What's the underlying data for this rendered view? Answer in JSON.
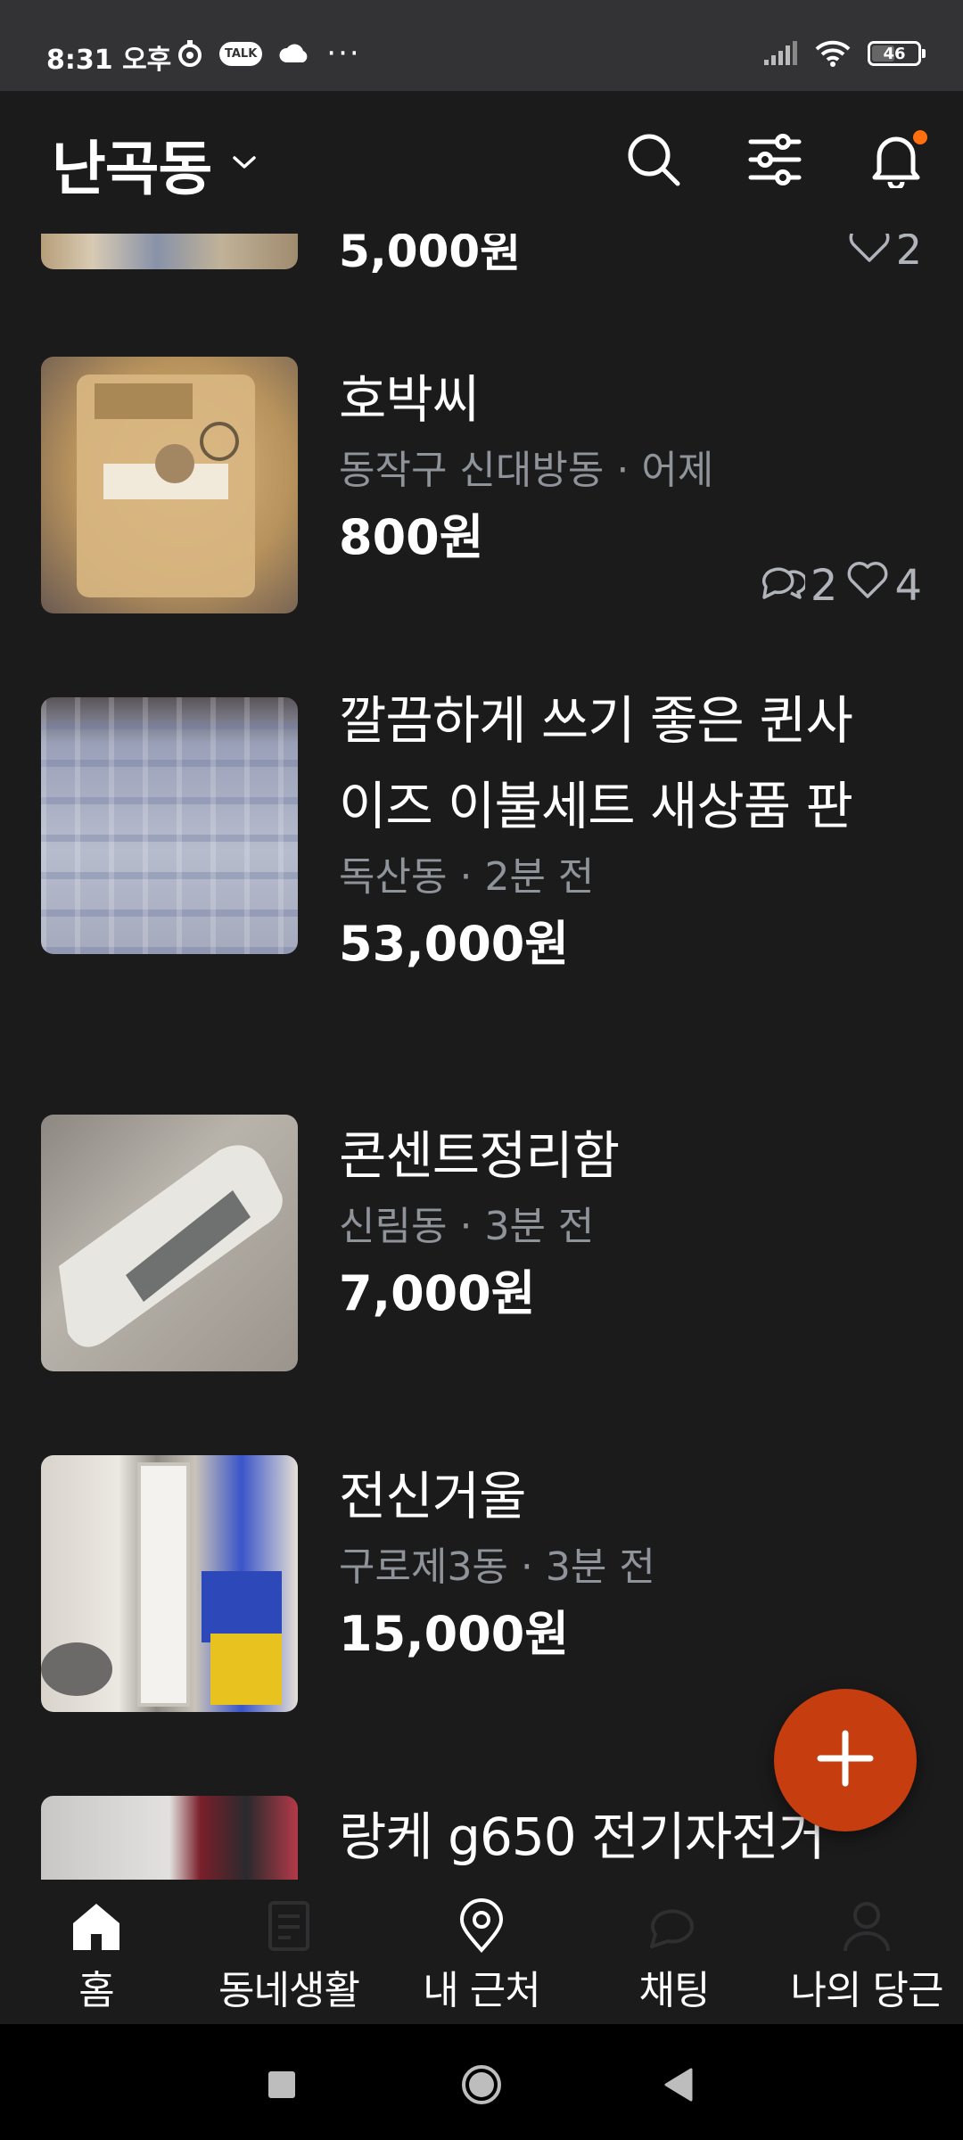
{
  "status_bar": {
    "time": "8:31 오후",
    "talk_label": "TALK",
    "more": "···",
    "battery": "46"
  },
  "header": {
    "location": "난곡동"
  },
  "feed": {
    "partial_item": {
      "price": "5,000원",
      "likes": "2"
    },
    "items": [
      {
        "title": "호박씨",
        "location": "동작구 신대방동",
        "time": "어제",
        "price": "800원",
        "chats": "2",
        "likes": "4"
      },
      {
        "title_line1": "깔끔하게 쓰기 좋은 퀸사",
        "title_line2": "이즈 이불세트 새상품 판",
        "location": "독산동",
        "time": "2분 전",
        "price": "53,000원"
      },
      {
        "title": "콘센트정리함",
        "location": "신림동",
        "time": "3분 전",
        "price": "7,000원"
      },
      {
        "title": "전신거울",
        "location": "구로제3동",
        "time": "3분 전",
        "price": "15,000원"
      },
      {
        "title": "랑케 g650 전기자전거"
      }
    ],
    "separator": "·"
  },
  "bottom_nav": {
    "items": [
      {
        "label": "홈",
        "icon": "home-icon"
      },
      {
        "label": "동네생활",
        "icon": "document-icon"
      },
      {
        "label": "내 근처",
        "icon": "location-pin-icon"
      },
      {
        "label": "채팅",
        "icon": "chat-icon"
      },
      {
        "label": "나의 당근",
        "icon": "person-icon"
      }
    ]
  },
  "colors": {
    "background": "#1b1b1c",
    "accent": "#ff6f0f",
    "fab": "#c63d0f",
    "meta_text": "#8f939a"
  }
}
